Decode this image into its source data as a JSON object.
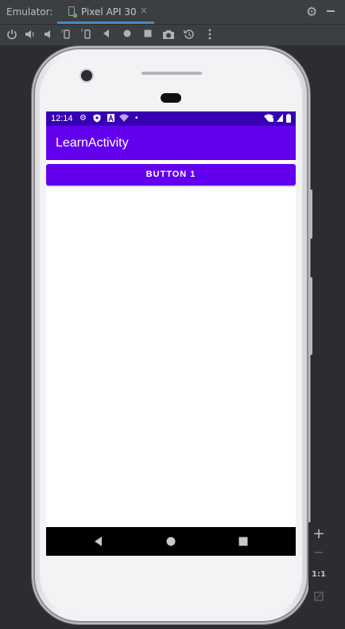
{
  "tool_window": {
    "title": "Emulator:",
    "tab_label": "Pixel API 30",
    "tab_close": "×"
  },
  "toolbar": {
    "buttons": [
      "power-icon",
      "volume-up-icon",
      "volume-down-icon",
      "rotate-left-icon",
      "rotate-right-icon",
      "back-icon",
      "home-icon",
      "overview-icon",
      "screenshot-icon",
      "snapshot-icon",
      "more-icon"
    ]
  },
  "device": {
    "status_bar": {
      "time": "12:14",
      "icons": [
        "gear-icon",
        "shield-icon",
        "a-icon",
        "wifi-icon",
        "dot-icon",
        "signal-icon",
        "battery-icon"
      ]
    },
    "app_bar": {
      "title": "LearnActivity"
    },
    "content": {
      "button1_label": "BUTTON 1"
    },
    "colors": {
      "primary": "#6200ee",
      "primary_dark": "#3700b3",
      "nav_bar": "#000000"
    }
  },
  "zoom_controls": {
    "zoom_in": "+",
    "zoom_out": "−",
    "actual_size": "1:1"
  }
}
